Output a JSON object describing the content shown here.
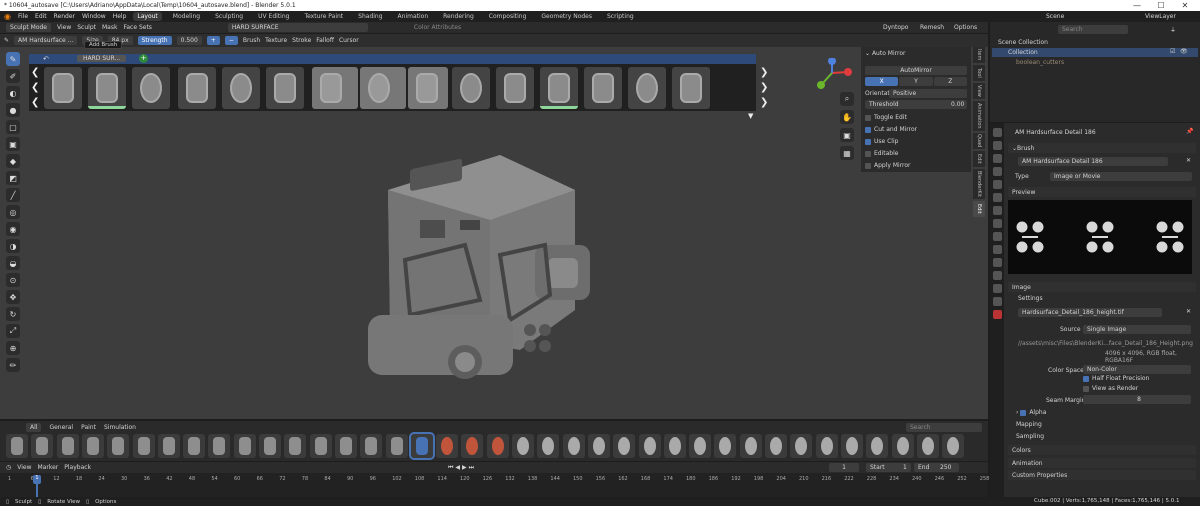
{
  "window": {
    "title": "* 10604_autosave [C:\\Users\\Adriano\\AppData\\Local\\Temp\\10604_autosave.blend] - Blender 5.0.1",
    "minimize": "—",
    "maximize": "☐",
    "close": "✕"
  },
  "menubar": {
    "items": [
      "File",
      "Edit",
      "Render",
      "Window",
      "Help"
    ],
    "workspaces": [
      "Layout",
      "Modeling",
      "Sculpting",
      "UV Editing",
      "Texture Paint",
      "Shading",
      "Animation",
      "Rendering",
      "Compositing",
      "Geometry Nodes",
      "Scripting"
    ],
    "active_workspace": "Layout",
    "scene": "Scene",
    "view_layer": "ViewLayer"
  },
  "header": {
    "mode": "Sculpt Mode",
    "menus": [
      "View",
      "Sculpt",
      "Mask",
      "Face Sets"
    ],
    "search_value": "HARD SURFACE",
    "color_attributes": "Color Attributes",
    "dyntopo": "Dyntopo",
    "remesh": "Remesh",
    "options": "Options"
  },
  "tool_header": {
    "brush_name": "AM Hardsurface ...",
    "size_label": "Size",
    "size_value": "84 px",
    "strength_label": "Strength",
    "strength_value": "0.500",
    "menus": [
      "Brush",
      "Texture",
      "Stroke",
      "Falloff",
      "Cursor"
    ]
  },
  "brush_strip": {
    "tab_label": "HARD SUR...",
    "tooltip": "Add Brush"
  },
  "npanel": {
    "title": "Auto Mirror",
    "button": "AutoMirror",
    "axes": [
      "X",
      "Y",
      "Z"
    ],
    "orientation_label": "Orientat...",
    "orientation_value": "Positive",
    "threshold_label": "Threshold",
    "threshold_value": "0.00",
    "options": [
      {
        "label": "Toggle Edit",
        "checked": false
      },
      {
        "label": "Cut and Mirror",
        "checked": true
      },
      {
        "label": "Use Clip",
        "checked": true
      },
      {
        "label": "Editable",
        "checked": false
      },
      {
        "label": "Apply Mirror",
        "checked": false
      }
    ],
    "tabs": [
      "Item",
      "Tool",
      "View",
      "Animation",
      "Quad",
      "Edit",
      "BlenderKit",
      "Edit"
    ]
  },
  "outliner": {
    "search_placeholder": "Search",
    "items": [
      "Scene Collection",
      "Collection",
      "boolean_cutters"
    ]
  },
  "properties": {
    "brush_title": "AM Hardsurface Detail 186",
    "brush_section": "Brush",
    "texture_name": "AM Hardsurface Detail 186",
    "type_label": "Type",
    "type_value": "Image or Movie",
    "preview_section": "Preview",
    "image_section": "Image",
    "settings_section": "Settings",
    "image_name": "Hardsurface_Detail_186_height.tif",
    "source_label": "Source",
    "source_value": "Single Image",
    "filepath": "//assets\\misc\\Files\\BlenderKi...face_Detail_186_Height.png",
    "image_info": "4096 x 4096, RGB float, RGBA16F",
    "color_space_label": "Color Space",
    "color_space_value": "Non-Color",
    "half_float": "Half Float Precision",
    "view_as_render": "View as Render",
    "seam_margin_label": "Seam Margin",
    "seam_margin_value": "8",
    "alpha": "Alpha",
    "mapping": "Mapping",
    "sampling": "Sampling",
    "colors": "Colors",
    "animation": "Animation",
    "custom_properties": "Custom Properties"
  },
  "shelf": {
    "tabs": [
      "All",
      "General",
      "Paint",
      "Simulation"
    ],
    "search_placeholder": "Search"
  },
  "timeline": {
    "menus": [
      "View",
      "Marker",
      "Playback"
    ],
    "current_frame": "1",
    "start_label": "Start",
    "start_value": "1",
    "end_label": "End",
    "end_value": "250",
    "ticks": [
      "1",
      "6",
      "12",
      "18",
      "24",
      "30",
      "36",
      "42",
      "48",
      "54",
      "60",
      "66",
      "72",
      "78",
      "84",
      "90",
      "96",
      "102",
      "108",
      "114",
      "120",
      "126",
      "132",
      "138",
      "144",
      "150",
      "156",
      "162",
      "168",
      "174",
      "180",
      "186",
      "192",
      "198",
      "204",
      "210",
      "216",
      "222",
      "228",
      "234",
      "240",
      "246",
      "252",
      "258"
    ]
  },
  "status": {
    "sculpt": "Sculpt",
    "rotate": "Rotate View",
    "options": "Options",
    "stats": "Cube.002 | Verts:1,765,148 | Faces:1,765,146 | 5.0.1"
  },
  "colors": {
    "accent": "#4772b3",
    "viewport_bg": "#3d3d3d",
    "panel_bg": "#2b2b2b"
  }
}
